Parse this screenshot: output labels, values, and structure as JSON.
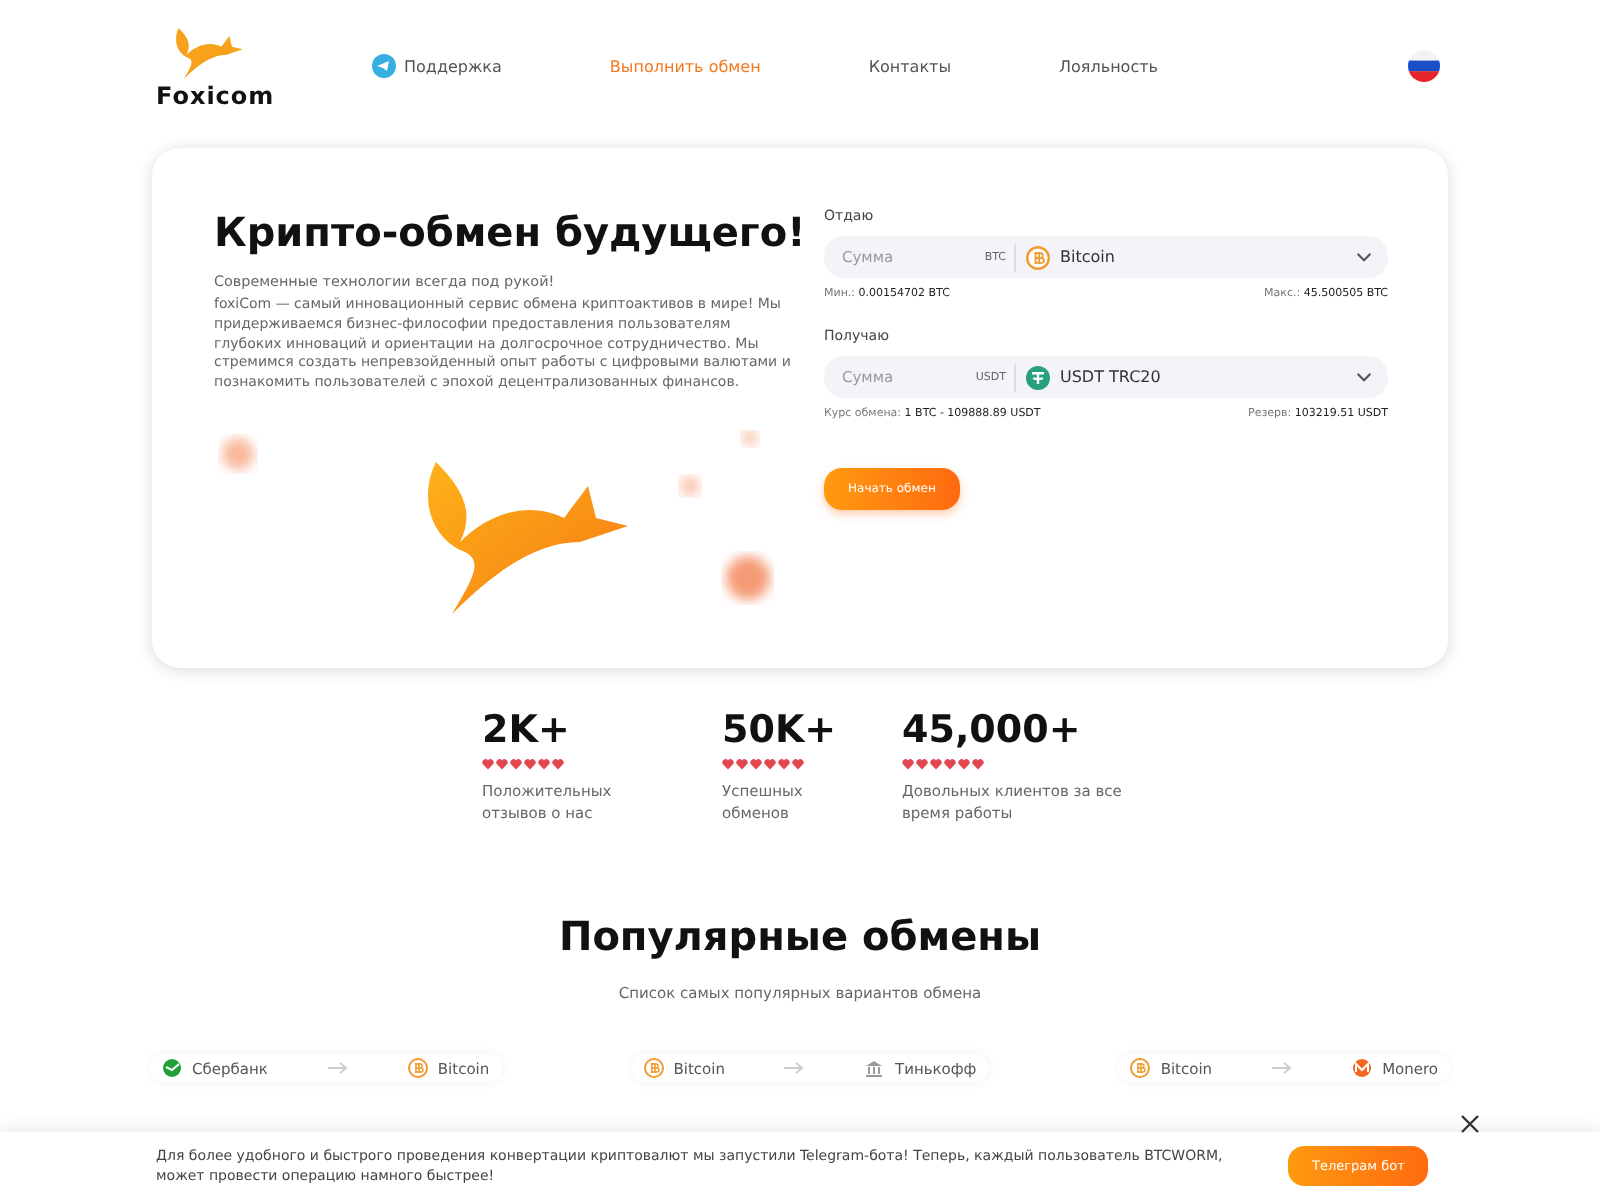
{
  "header": {
    "logo": "Foxicom",
    "nav": [
      {
        "label": "Поддержка",
        "selected": false,
        "kind": "telegram"
      },
      {
        "label": "Выполнить обмен",
        "selected": true,
        "kind": "plain"
      },
      {
        "label": "Контакты",
        "selected": false,
        "kind": "plain"
      },
      {
        "label": "Лояльность",
        "selected": false,
        "kind": "plain"
      }
    ]
  },
  "hero": {
    "title": "Крипто-обмен будущего!",
    "subtitle": "Современные технологии всегда под рукой!",
    "description": "foxiCom — самый инновационный сервис обмена криптоактивов в мире! Мы придерживаемся бизнес-философии предоставления пользователям глубоких инноваций и ориентации на долгосрочное сотрудничество. Мы стремимся создать непревзойденный опыт работы с цифровыми валютами и познакомить пользователей с эпохой децентрализованных финансов."
  },
  "exchange": {
    "give": {
      "label": "Отдаю",
      "placeholder": "Сумма",
      "unit": "BTC",
      "currency": {
        "name": "Bitcoin",
        "kind": "btc"
      },
      "left_label": "Мин.:",
      "left_value": "0.00154702 BTC",
      "right_label": "Макс.:",
      "right_value": "45.500505 BTC"
    },
    "get": {
      "label": "Получаю",
      "placeholder": "Сумма",
      "unit": "USDT",
      "currency": {
        "name": "USDT TRC20",
        "kind": "usdt"
      },
      "left_label": "Курс обмена:",
      "left_value": "1 BTC - 109888.89 USDT",
      "right_label": "Резерв:",
      "right_value": "103219.51 USDT"
    },
    "button": "Начать обмен"
  },
  "stats": [
    {
      "value": "2K+",
      "stars": 6,
      "caption": "Положительных отзывов о нас"
    },
    {
      "value": "50K+",
      "stars": 6,
      "caption": "Успешных обменов"
    },
    {
      "value": "45,000+",
      "stars": 6,
      "caption": "Довольных клиентов за все время работы"
    }
  ],
  "popular": {
    "title": "Популярные обмены",
    "subtitle": "Список самых популярных вариантов обмена",
    "pairs": [
      {
        "from": {
          "name": "Сбербанк",
          "kind": "sber"
        },
        "to": {
          "name": "Bitcoin",
          "kind": "btc"
        }
      },
      {
        "from": {
          "name": "Bitcoin",
          "kind": "btc"
        },
        "to": {
          "name": "Тинькофф",
          "kind": "bank"
        }
      },
      {
        "from": {
          "name": "Bitcoin",
          "kind": "btc"
        },
        "to": {
          "name": "Monero",
          "kind": "xmr"
        }
      }
    ]
  },
  "banner": {
    "text": "Для более удобного и быстрого проведения конвертации криптовалют мы запустили Telegram-бота! Теперь, каждый пользователь BTCWORM, может провести операцию намного быстрее!",
    "button": "Телеграм бот"
  }
}
